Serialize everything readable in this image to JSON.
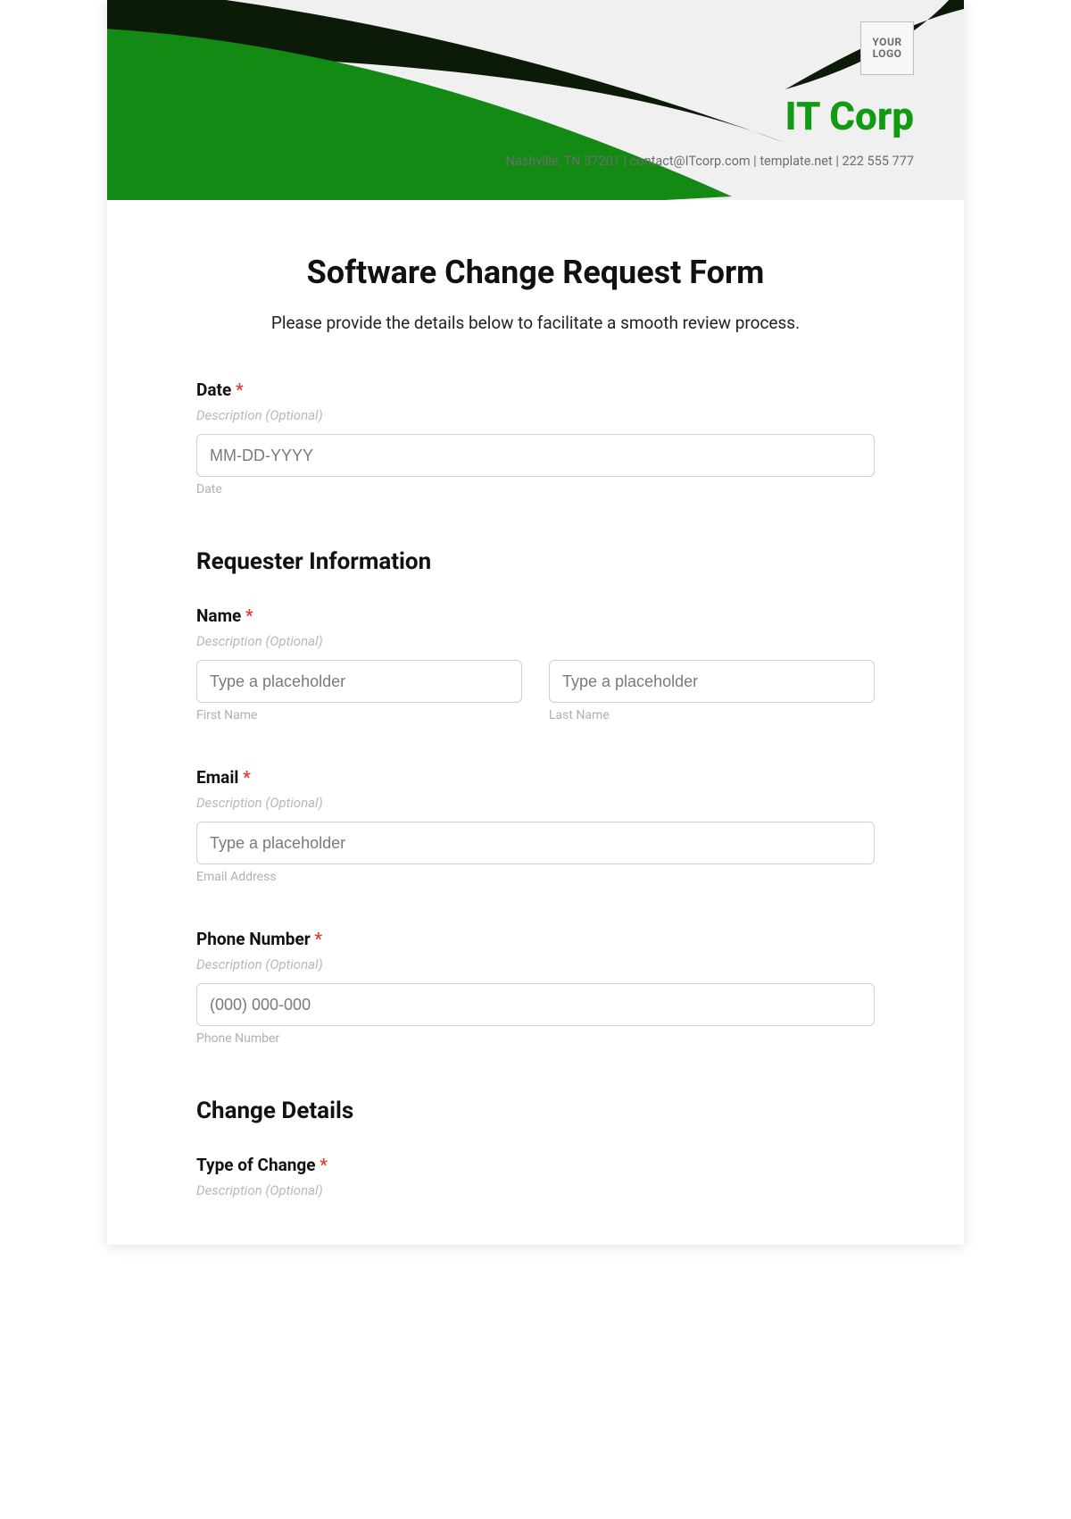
{
  "header": {
    "logo_text": "YOUR\nLOGO",
    "company_name": "IT Corp",
    "contact_line": "Nashville, TN 37201 | contact@ITcorp.com | template.net | 222 555 777"
  },
  "form": {
    "title": "Software Change Request Form",
    "intro": "Please provide the details below to facilitate a smooth review process.",
    "required_mark": "*",
    "fields": {
      "date": {
        "label": "Date",
        "desc": "Description (Optional)",
        "placeholder": "MM-DD-YYYY",
        "sublabel": "Date"
      },
      "requester_section": "Requester Information",
      "name": {
        "label": "Name",
        "desc": "Description (Optional)",
        "first_placeholder": "Type a placeholder",
        "first_sublabel": "First Name",
        "last_placeholder": "Type a placeholder",
        "last_sublabel": "Last Name"
      },
      "email": {
        "label": "Email",
        "desc": "Description (Optional)",
        "placeholder": "Type a placeholder",
        "sublabel": "Email Address"
      },
      "phone": {
        "label": "Phone Number",
        "desc": "Description (Optional)",
        "placeholder": "(000) 000-000",
        "sublabel": "Phone Number"
      },
      "change_section": "Change Details",
      "type_of_change": {
        "label": "Type of Change",
        "desc": "Description (Optional)"
      }
    }
  }
}
